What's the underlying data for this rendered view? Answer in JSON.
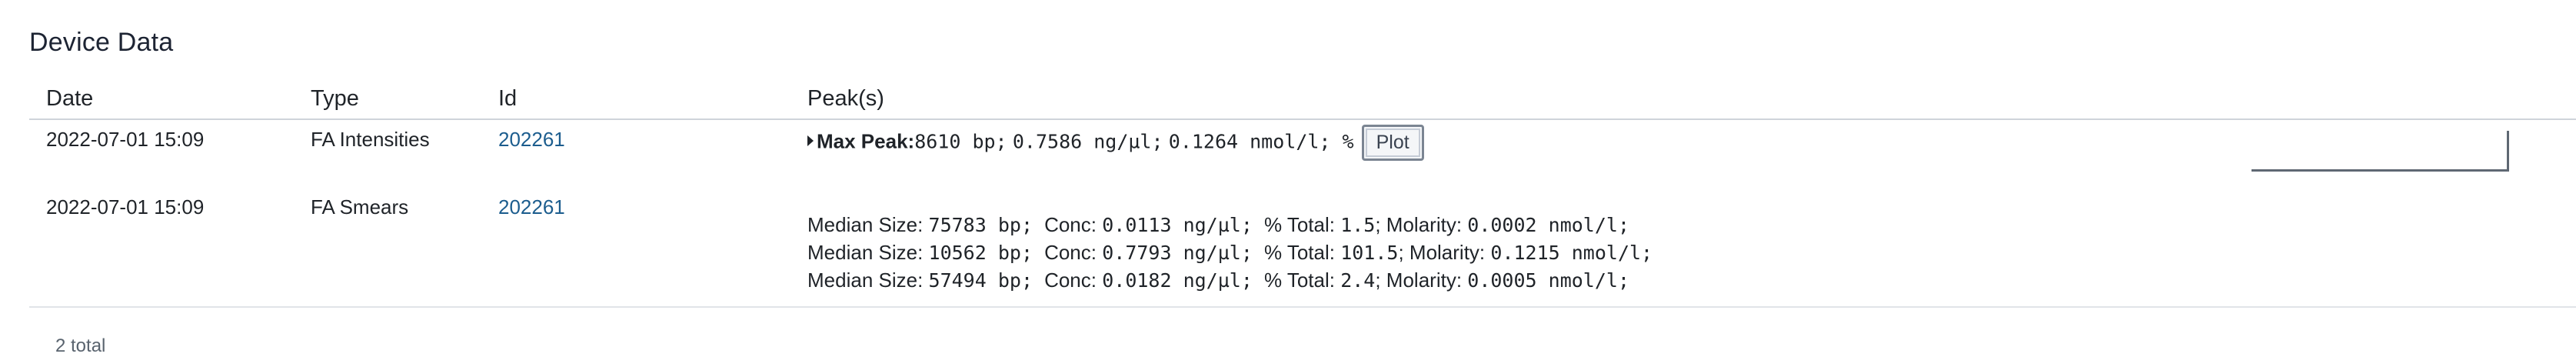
{
  "section": {
    "title": "Device Data"
  },
  "table": {
    "headers": {
      "date": "Date",
      "type": "Type",
      "id": "Id",
      "peaks": "Peak(s)"
    },
    "rows": [
      {
        "date": "2022-07-01 15:09",
        "type": "FA Intensities",
        "id": "202261",
        "max_peak": {
          "label": "Max Peak:",
          "size": "8610",
          "size_unit": " bp;",
          "conc": "0.7586",
          "conc_unit": " ng/µl;",
          "molarity": "0.1264",
          "molarity_unit": " nmol/l;",
          "percent": " %"
        },
        "plot_label": "Plot"
      },
      {
        "date": "2022-07-01 15:09",
        "type": "FA Smears",
        "id": "202261",
        "smears": [
          {
            "size_label": "Median Size: ",
            "size": "75783",
            "size_unit": " bp; ",
            "conc_label": "Conc: ",
            "conc": "0.0113",
            "conc_unit": " ng/µl; ",
            "total_label": "% Total: ",
            "total": "1.5",
            "molarity_label": "; Molarity: ",
            "molarity": "0.0002",
            "molarity_unit": " nmol/l;"
          },
          {
            "size_label": "Median Size: ",
            "size": "10562",
            "size_unit": " bp; ",
            "conc_label": "Conc: ",
            "conc": "0.7793",
            "conc_unit": " ng/µl; ",
            "total_label": "% Total: ",
            "total": "101.5",
            "molarity_label": "; Molarity: ",
            "molarity": "0.1215",
            "molarity_unit": " nmol/l;"
          },
          {
            "size_label": "Median Size: ",
            "size": "57494",
            "size_unit": " bp; ",
            "conc_label": "Conc: ",
            "conc": "0.0182",
            "conc_unit": " ng/µl; ",
            "total_label": "% Total: ",
            "total": "2.4",
            "molarity_label": "; Molarity: ",
            "molarity": "0.0005",
            "molarity_unit": " nmol/l;"
          }
        ]
      }
    ],
    "total_text": "2 total"
  }
}
